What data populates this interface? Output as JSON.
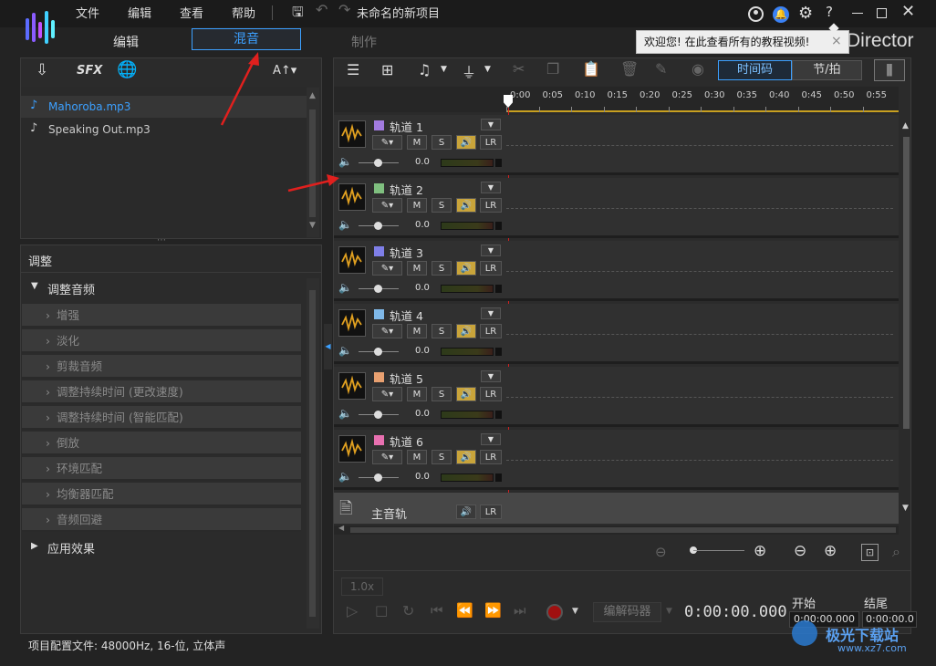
{
  "menu": {
    "file": "文件",
    "edit": "编辑",
    "view": "查看",
    "help": "帮助",
    "project_title": "未命名的新项目"
  },
  "modes": {
    "edit": "编辑",
    "mix": "混音",
    "produce": "制作"
  },
  "tooltip": {
    "text": "欢迎您! 在此查看所有的教程视频!",
    "close": "×"
  },
  "brand": {
    "partial": "Director"
  },
  "library": {
    "tools": {
      "sfx": "SFX",
      "text": "A↑▾"
    },
    "items": [
      {
        "name": "Mahoroba.mp3"
      },
      {
        "name": "Speaking Out.mp3"
      }
    ]
  },
  "adjust": {
    "header": "调整",
    "section": "调整音频",
    "items": [
      "增强",
      "淡化",
      "剪裁音频",
      "调整持续时间 (更改速度)",
      "调整持续时间 (智能匹配)",
      "倒放",
      "环境匹配",
      "均衡器匹配",
      "音频回避"
    ],
    "effects": "应用效果"
  },
  "status": {
    "text": "项目配置文件: 48000Hz, 16-位, 立体声"
  },
  "toolbar": {
    "timecode": "时间码",
    "beats": "节/拍"
  },
  "ruler": [
    "0:00",
    "0:05",
    "0:10",
    "0:15",
    "0:20",
    "0:25",
    "0:30",
    "0:35",
    "0:40",
    "0:45",
    "0:50",
    "0:55"
  ],
  "tracks": [
    {
      "name": "轨道 1",
      "color": "#a27be0",
      "volume": "0.0",
      "m": "M",
      "s": "S",
      "lr": "LR"
    },
    {
      "name": "轨道 2",
      "color": "#7fbf7f",
      "volume": "0.0",
      "m": "M",
      "s": "S",
      "lr": "LR"
    },
    {
      "name": "轨道 3",
      "color": "#7f7fe8",
      "volume": "0.0",
      "m": "M",
      "s": "S",
      "lr": "LR"
    },
    {
      "name": "轨道 4",
      "color": "#7fb8e8",
      "volume": "0.0",
      "m": "M",
      "s": "S",
      "lr": "LR"
    },
    {
      "name": "轨道 5",
      "color": "#e8a070",
      "volume": "0.0",
      "m": "M",
      "s": "S",
      "lr": "LR"
    },
    {
      "name": "轨道 6",
      "color": "#e870b0",
      "volume": "0.0",
      "m": "M",
      "s": "S",
      "lr": "LR"
    }
  ],
  "master": {
    "name": "主音轨",
    "lr": "LR"
  },
  "playback": {
    "speed": "1.0x",
    "codec": "编解码器",
    "timecode": "0:00:00.000",
    "start_label": "开始",
    "end_label": "结尾",
    "start_value": "0:00:00.000",
    "end_value": "0:00:00.0"
  },
  "watermark": {
    "text": "极光下载站",
    "url": "www.xz7.com"
  }
}
